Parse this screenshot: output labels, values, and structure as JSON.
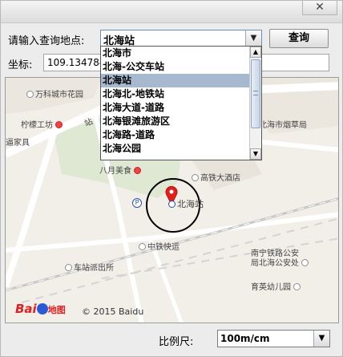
{
  "window": {
    "close_glyph": "✕"
  },
  "search": {
    "label": "请输入查询地点:",
    "value": "北海站",
    "query_button": "查询"
  },
  "coordinates": {
    "label": "坐标:",
    "value": "109.134784"
  },
  "dropdown": {
    "items": [
      "北海市",
      "北海-公交车站",
      "北海站",
      "北海北-地铁站",
      "北海大道-道路",
      "北海银滩旅游区",
      "北海路-道路",
      "北海公园"
    ],
    "selected_index": 2
  },
  "map": {
    "pois": {
      "vanke": "万科城市花园",
      "lemon": "柠檬工坊",
      "home": "逼家具",
      "bayue": "八月美食",
      "highspeed_hotel": "高铁大酒店",
      "tobacco": "北海市烟草局",
      "station": "北海站",
      "zhongtie": "中铁快运",
      "police_station": "车站派出所",
      "railway_police": "南宁铁路公安\n局北海公安处",
      "kindergarten": "育英幼儿园",
      "road_fragment": "站"
    },
    "parking_glyph": "P",
    "logo_text": "Bai",
    "logo_sub": "地图",
    "copyright": "© 2015 Baidu",
    "colors": {
      "road": "#ffffff",
      "block": "#dfe8d2",
      "rail": "#c8c8c8",
      "pin": "#e0201a"
    }
  },
  "scale": {
    "label": "比例尺:",
    "value": "100m/cm"
  }
}
